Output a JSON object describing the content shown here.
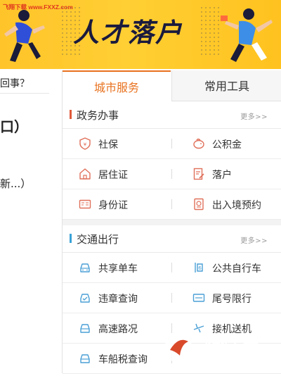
{
  "banner": {
    "watermark": "飞翔下载 www.FXXZ.com",
    "title": "人才落户"
  },
  "left_fragments": {
    "line1": "回事？",
    "line2": "口）",
    "line3": "新...）"
  },
  "tabs": [
    {
      "label": "城市服务",
      "active": true
    },
    {
      "label": "常用工具",
      "active": false
    }
  ],
  "sections": [
    {
      "name": "政务办事",
      "more": "更多>>",
      "bar_color": "#e05a3a",
      "items": [
        {
          "label": "社保",
          "icon": "social-security-icon"
        },
        {
          "label": "公积金",
          "icon": "piggy-bank-icon"
        },
        {
          "label": "居住证",
          "icon": "home-icon"
        },
        {
          "label": "落户",
          "icon": "document-edit-icon"
        },
        {
          "label": "身份证",
          "icon": "id-card-icon"
        },
        {
          "label": "出入境预约",
          "icon": "passport-icon"
        }
      ]
    },
    {
      "name": "交通出行",
      "more": "更多>>",
      "bar_color": "#3aa3d8",
      "items": [
        {
          "label": "共享单车",
          "icon": "car-icon"
        },
        {
          "label": "公共自行车",
          "icon": "bike-counter-icon"
        },
        {
          "label": "违章查询",
          "icon": "violation-check-icon"
        },
        {
          "label": "尾号限行",
          "icon": "license-plate-icon"
        },
        {
          "label": "高速路况",
          "icon": "car-icon"
        },
        {
          "label": "接机送机",
          "icon": "plane-icon"
        },
        {
          "label": "车船税查询",
          "icon": "car-icon"
        }
      ]
    }
  ],
  "overlay_logo": {
    "name": "飞翔下载",
    "url": "WWW.FXXZ.COM"
  },
  "colors": {
    "accent": "#e8711e",
    "icon_red": "#e0705a",
    "icon_blue": "#4a9fd6"
  }
}
